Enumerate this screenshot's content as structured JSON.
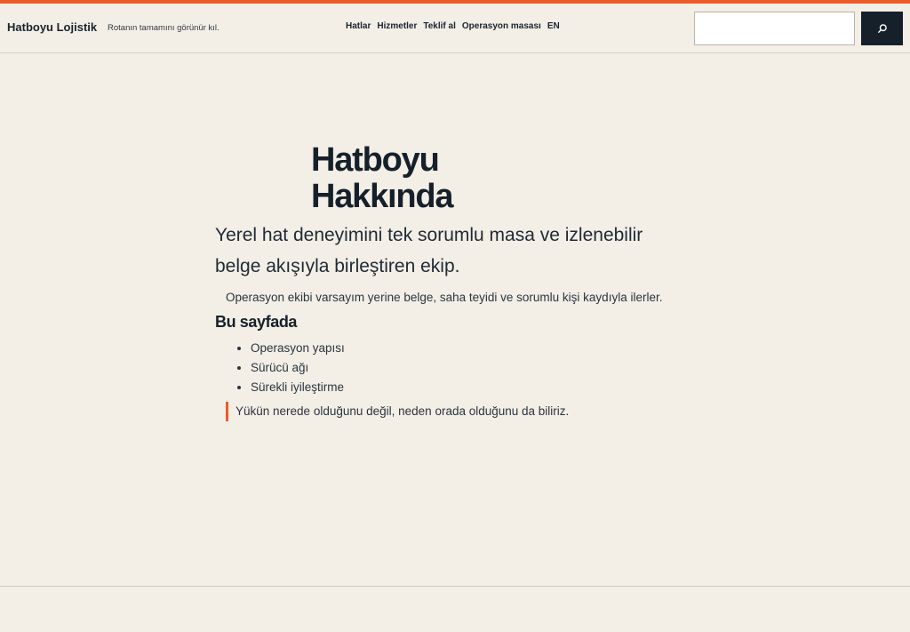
{
  "header": {
    "brand": "Hatboyu Lojistik",
    "tagline": "Rotanın tamamını görünür kıl.",
    "nav": [
      {
        "label": "Hatlar"
      },
      {
        "label": "Hizmetler"
      },
      {
        "label": "Teklif al"
      },
      {
        "label": "Operasyon masası"
      },
      {
        "label": "EN"
      }
    ],
    "search": {
      "value": "",
      "placeholder": "",
      "button_icon": "search-icon"
    }
  },
  "main": {
    "title": "Hatboyu Hakkında",
    "lead": "Yerel hat deneyimini tek sorumlu masa ve izlenebilir belge akışıyla birleştiren ekip.",
    "intro": "Operasyon ekibi varsayım yerine belge, saha teyidi ve sorumlu kişi kaydıyla ilerler.",
    "section_heading": "Bu sayfada",
    "toc": [
      "Operasyon yapısı",
      "Sürücü ağı",
      "Sürekli iyileştirme"
    ],
    "quote": "Yükün nerede olduğunu değil, neden orada olduğunu da biliriz."
  },
  "colors": {
    "accent": "#f05a28",
    "background": "#f3efe6",
    "dark": "#16202b"
  }
}
